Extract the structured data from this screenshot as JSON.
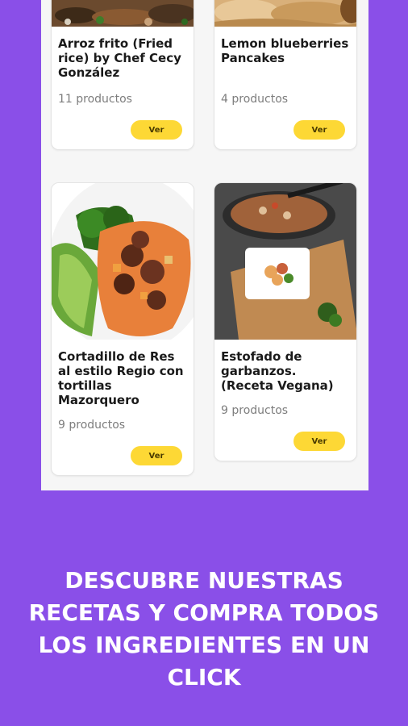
{
  "recipes": [
    {
      "title": "Arroz frito (Fried rice) by Chef Cecy González",
      "count": "11 productos",
      "button": "Ver"
    },
    {
      "title": "Lemon blueberries Pancakes",
      "count": "4 productos",
      "button": "Ver"
    },
    {
      "title": "Cortadillo de Res al estilo Regio con tortillas Mazorquero",
      "count": "9 productos",
      "button": "Ver"
    },
    {
      "title": "Estofado de garbanzos. (Receta Vegana)",
      "count": "9 productos",
      "button": "Ver"
    }
  ],
  "caption": "DESCUBRE NUESTRAS RECETAS Y COMPRA TODOS LOS INGREDIENTES EN UN CLICK",
  "colors": {
    "background": "#8a4fe8",
    "button": "#fdd835",
    "panel": "#f6f6f6"
  }
}
